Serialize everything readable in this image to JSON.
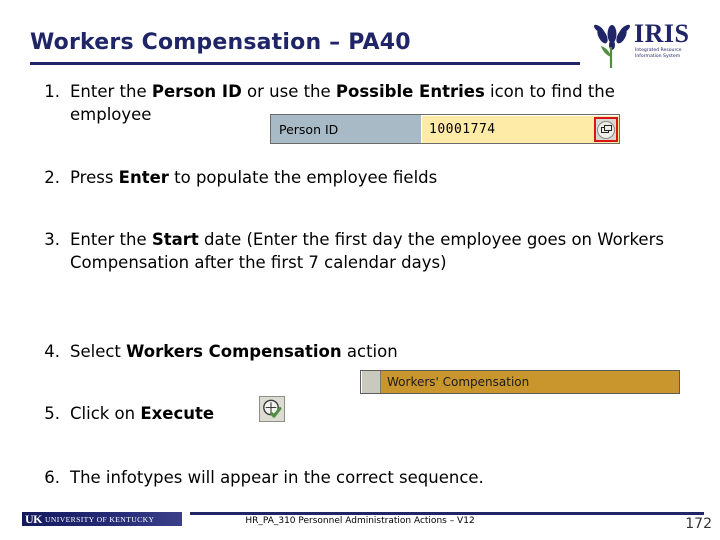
{
  "slide": {
    "title": "Workers Compensation – PA40",
    "title_color": "#1f2566"
  },
  "logo": {
    "wordmark": "IRIS",
    "tagline_line1": "Integrated Resource",
    "tagline_line2": "Information System",
    "flower_color": "#1f2566",
    "stem_color": "#4f8f3f"
  },
  "steps": [
    {
      "number": "1.",
      "parts": [
        {
          "text": "Enter the ",
          "bold": false
        },
        {
          "text": "Person ID",
          "bold": true
        },
        {
          "text": " or use the ",
          "bold": false
        },
        {
          "text": "Possible Entries",
          "bold": true
        },
        {
          "text": " icon to find the employee",
          "bold": false
        }
      ]
    },
    {
      "number": "2.",
      "parts": [
        {
          "text": "Press ",
          "bold": false
        },
        {
          "text": "Enter",
          "bold": true
        },
        {
          "text": " to populate the employee fields",
          "bold": false
        }
      ]
    },
    {
      "number": "3.",
      "parts": [
        {
          "text": "Enter the ",
          "bold": false
        },
        {
          "text": "Start",
          "bold": true
        },
        {
          "text": " date (Enter the first day the employee goes on Workers Compensation after the first 7 calendar days)",
          "bold": false
        }
      ]
    },
    {
      "number": "4.",
      "parts": [
        {
          "text": "Select ",
          "bold": false
        },
        {
          "text": "Workers Compensation",
          "bold": true
        },
        {
          "text": " action",
          "bold": false
        }
      ]
    },
    {
      "number": "5.",
      "parts": [
        {
          "text": "Click on ",
          "bold": false
        },
        {
          "text": "Execute",
          "bold": true
        }
      ]
    },
    {
      "number": "6.",
      "parts": [
        {
          "text": "The infotypes will appear in the correct sequence.",
          "bold": false
        }
      ]
    }
  ],
  "person_id_widget": {
    "label": "Person ID",
    "value": "10001774",
    "field_background": "#ffeba8",
    "label_background": "#a8bac6",
    "highlight_color": "#d81414",
    "icon_name": "possible-entries-icon"
  },
  "action_bar": {
    "label": "Workers' Compensation",
    "background": "#c9962e"
  },
  "execute_icon": {
    "icon_name": "execute-clock-check-icon",
    "check_color": "#4f8f3f"
  },
  "footer": {
    "uk_mark": "UK",
    "uk_name": "UNIVERSITY OF KENTUCKY",
    "course_text": "HR_PA_310 Personnel Administration Actions – V12",
    "page_number": "172",
    "rule_color": "#1f2566"
  }
}
